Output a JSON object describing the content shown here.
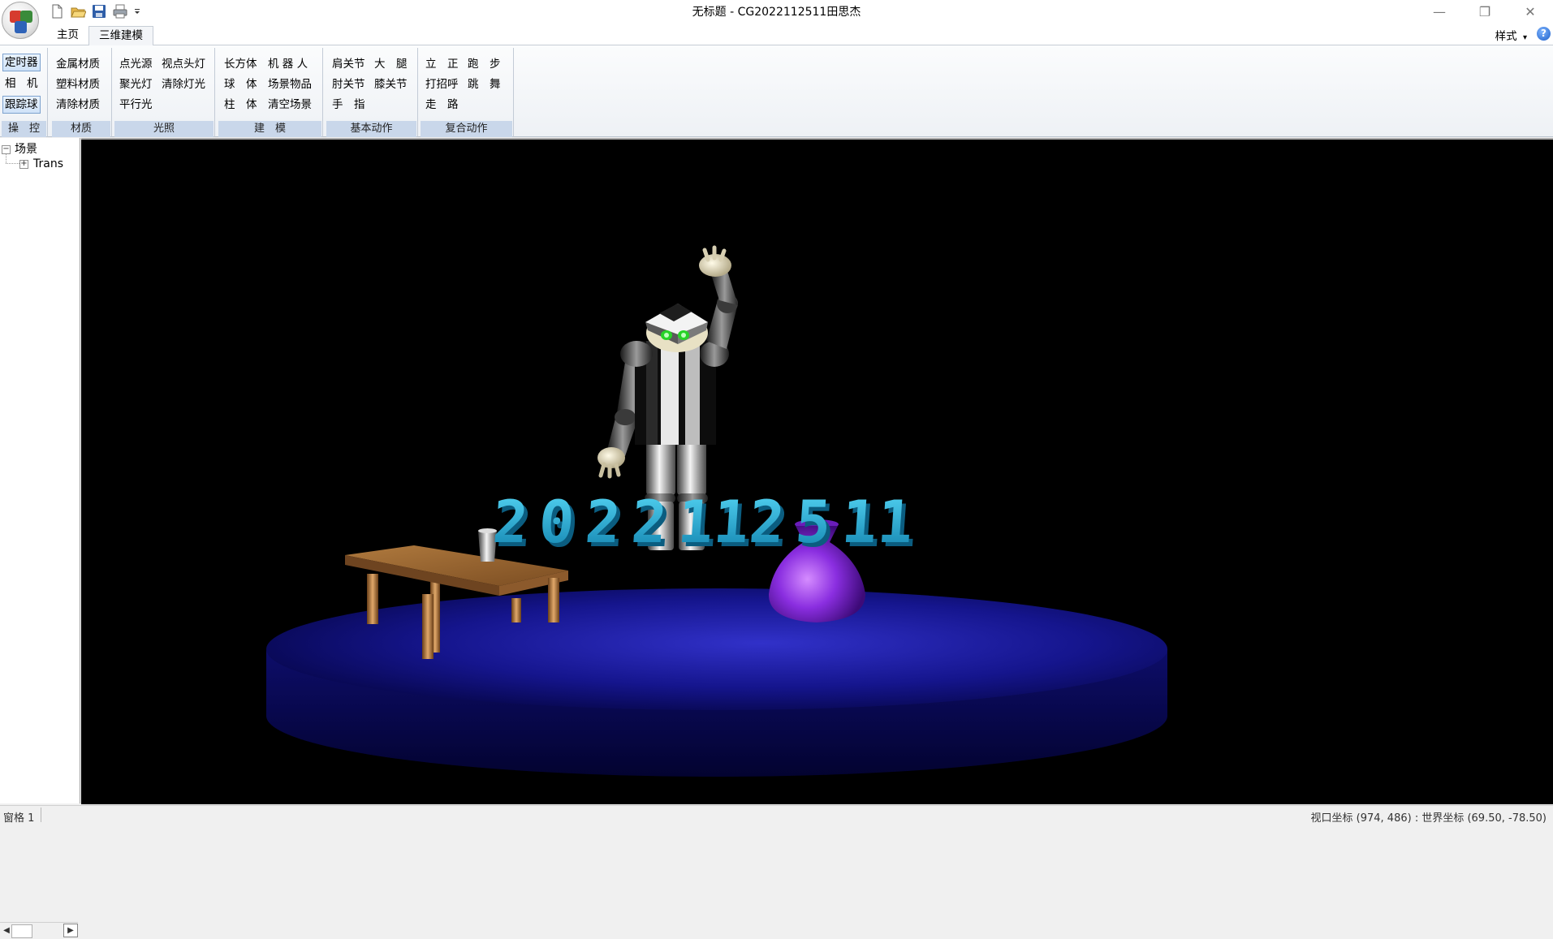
{
  "window": {
    "title": "无标题 - CG2022112511田思杰",
    "controls": {
      "minimize": "—",
      "restore": "❐",
      "close": "✕"
    }
  },
  "quick_access": [
    "new-icon",
    "open-icon",
    "save-icon",
    "print-icon",
    "customize-dropdown-icon"
  ],
  "tabs": [
    {
      "label": "主页",
      "selected": false
    },
    {
      "label": "三维建模",
      "selected": true
    }
  ],
  "style_menu": {
    "label": "样式",
    "arrow": "▾"
  },
  "help": {
    "glyph": "?"
  },
  "ribbon": {
    "groups": {
      "control": {
        "label": "操　控",
        "buttons": [
          "定时器",
          "相　机",
          "跟踪球"
        ]
      },
      "material": {
        "label": "材质",
        "buttons": [
          "金属材质",
          "塑料材质",
          "清除材质"
        ]
      },
      "lighting": {
        "label": "光照",
        "buttons": [
          "点光源",
          "视点头灯",
          "聚光灯",
          "清除灯光",
          "平行光"
        ]
      },
      "modeling": {
        "label": "建　模",
        "buttons": [
          "长方体",
          "机 器 人",
          "球　体",
          "场景物品",
          "柱　体",
          "清空场景"
        ]
      },
      "basic_motion": {
        "label": "基本动作",
        "buttons": [
          "肩关节",
          "大　腿",
          "肘关节",
          "膝关节",
          "手　指"
        ]
      },
      "compound_motion": {
        "label": "复合动作",
        "buttons": [
          "立　正",
          "跑　步",
          "打招呼",
          "跳　舞",
          "走　路"
        ]
      }
    }
  },
  "tree": {
    "root": {
      "label": "场景",
      "toggle": "−"
    },
    "child": {
      "label": "Trans",
      "toggle": "+"
    },
    "scroll": {
      "left": "◀",
      "right": "▶"
    }
  },
  "scene": {
    "digits_text": "2022112511",
    "colors": {
      "background": "#000000",
      "platform": "#0c0c73",
      "digits": "#1ea8d2",
      "table": "#8b5a2b",
      "vase": "#7a1fd0",
      "robot_metal": "#c8c8c8"
    }
  },
  "status": {
    "pane": "窗格 1",
    "coords": "视口坐标 (974, 486) : 世界坐标 (69.50, -78.50)"
  }
}
